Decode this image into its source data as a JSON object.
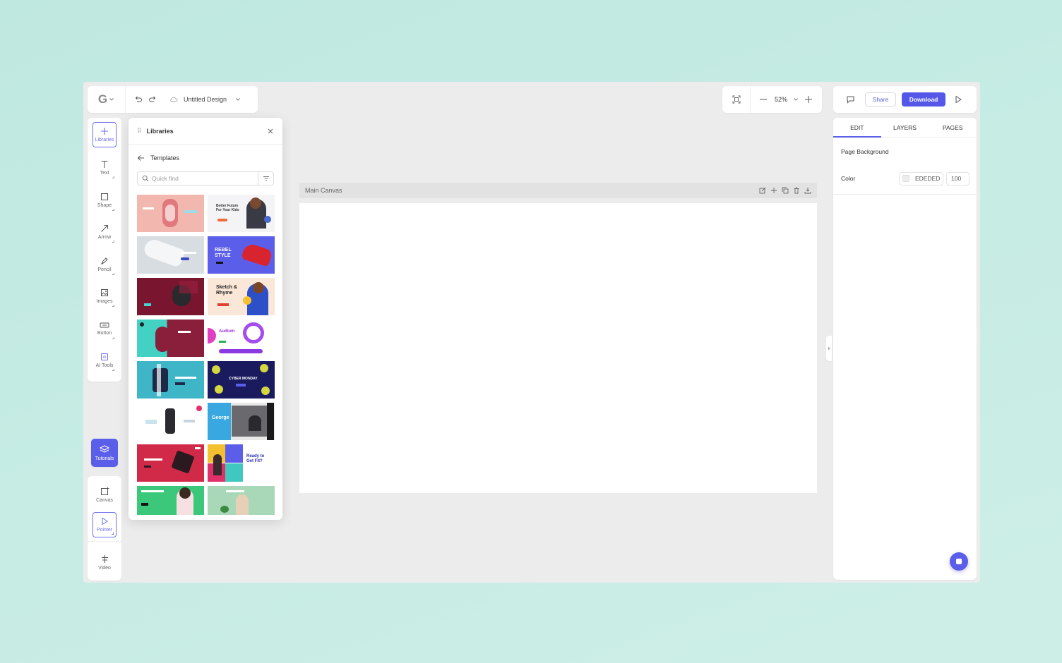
{
  "header": {
    "design_title": "Untitled Design",
    "zoom_level": "52%",
    "share_label": "Share",
    "download_label": "Download"
  },
  "left_toolbar": {
    "items": [
      {
        "label": "Libraries",
        "icon": "plus-icon"
      },
      {
        "label": "Text",
        "icon": "text-icon"
      },
      {
        "label": "Shape",
        "icon": "shape-icon"
      },
      {
        "label": "Arrow",
        "icon": "arrow-icon"
      },
      {
        "label": "Pencil",
        "icon": "pencil-icon"
      },
      {
        "label": "Images",
        "icon": "image-icon"
      },
      {
        "label": "Button",
        "icon": "button-icon"
      },
      {
        "label": "AI Tools",
        "icon": "ai-icon"
      }
    ],
    "tutorials_label": "Tutorials",
    "canvas_label": "Canvas",
    "pointer_label": "Pointer",
    "video_label": "Video"
  },
  "libraries": {
    "title": "Libraries",
    "section": "Templates",
    "search_placeholder": "Quick find",
    "thumbnails": [
      {
        "bg": "#f2b8b0",
        "text": "",
        "text_color": "#fff"
      },
      {
        "bg": "#f4f4f6",
        "text": "Better Future For Your Kids",
        "text_color": "#333"
      },
      {
        "bg": "#d8dde2",
        "text": "",
        "text_color": "#333"
      },
      {
        "bg": "#5b5ee8",
        "text": "REBEL STYLE",
        "text_color": "#fff"
      },
      {
        "bg": "#7a1530",
        "text": "",
        "text_color": "#fff"
      },
      {
        "bg": "#fbe7d8",
        "text": "Sketch & Rhyme",
        "text_color": "#222"
      },
      {
        "bg": "#43d1c4",
        "text": "",
        "text_color": "#fff"
      },
      {
        "bg": "#ffffff",
        "text": "Audium",
        "text_color": "#9b2ee0"
      },
      {
        "bg": "#3fb6c8",
        "text": "",
        "text_color": "#fff"
      },
      {
        "bg": "#1a1a5e",
        "text": "CYBER MONDAY",
        "text_color": "#fff"
      },
      {
        "bg": "#ffffff",
        "text": "",
        "text_color": "#333"
      },
      {
        "bg": "#3aa8e0",
        "text": "George",
        "text_color": "#fff"
      },
      {
        "bg": "#d02a48",
        "text": "",
        "text_color": "#fff"
      },
      {
        "bg": "#ffffff",
        "text": "Ready to Get Fit?",
        "text_color": "#2a2ab0"
      },
      {
        "bg": "#3cc87a",
        "text": "",
        "text_color": "#fff"
      },
      {
        "bg": "#a8d8b8",
        "text": "",
        "text_color": "#fff"
      }
    ]
  },
  "canvas": {
    "name": "Main Canvas"
  },
  "right_panel": {
    "tabs": [
      "EDIT",
      "LAYERS",
      "PAGES"
    ],
    "active_tab": "EDIT",
    "page_background_label": "Page Background",
    "color_label": "Color",
    "color_value": "EDEDED",
    "opacity_value": "100"
  },
  "colors": {
    "accent": "#5b5ee8",
    "page_bg": "#ededed"
  }
}
